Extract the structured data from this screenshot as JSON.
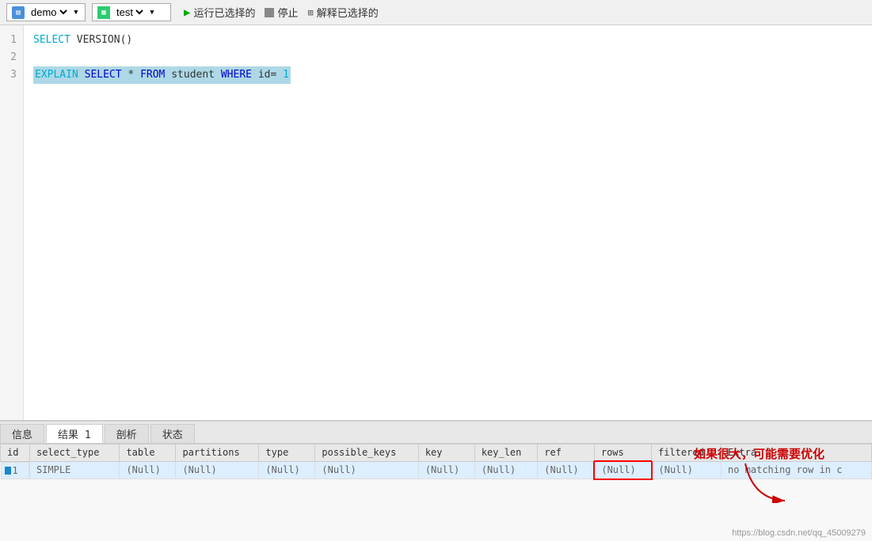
{
  "toolbar": {
    "db_label": "demo",
    "table_label": "test",
    "run_label": "运行已选择的",
    "stop_label": "停止",
    "explain_label": "解释已选择的"
  },
  "editor": {
    "lines": [
      {
        "num": "1",
        "content": "select_version"
      },
      {
        "num": "2",
        "content": "empty"
      },
      {
        "num": "3",
        "content": "explain_select"
      }
    ],
    "line1_text": "SELECT VERSION()",
    "line2_text": "",
    "line3_text": "EXPLAIN SELECT * FROM student WHERE id=1"
  },
  "tabs": [
    {
      "id": "info",
      "label": "信息"
    },
    {
      "id": "result1",
      "label": "结果 1",
      "active": true
    },
    {
      "id": "analyze",
      "label": "剖析"
    },
    {
      "id": "status",
      "label": "状态"
    }
  ],
  "table": {
    "headers": [
      "id",
      "select_type",
      "table",
      "partitions",
      "type",
      "possible_keys",
      "key",
      "key_len",
      "ref",
      "rows",
      "filtered",
      "Extra"
    ],
    "rows": [
      {
        "id": "1",
        "select_type": "SIMPLE",
        "table": "(Null)",
        "partitions": "(Null)",
        "type": "(Null)",
        "possible_keys": "(Null)",
        "key": "(Null)",
        "key_len": "(Null)",
        "ref": "(Null)",
        "rows": "(Null)",
        "filtered": "(Null)",
        "extra": "no matching row in c"
      }
    ]
  },
  "annotation": {
    "text": "如果很大，可能需要优化",
    "color": "#cc0000"
  },
  "watermark": "https://blog.csdn.net/qq_45009279"
}
